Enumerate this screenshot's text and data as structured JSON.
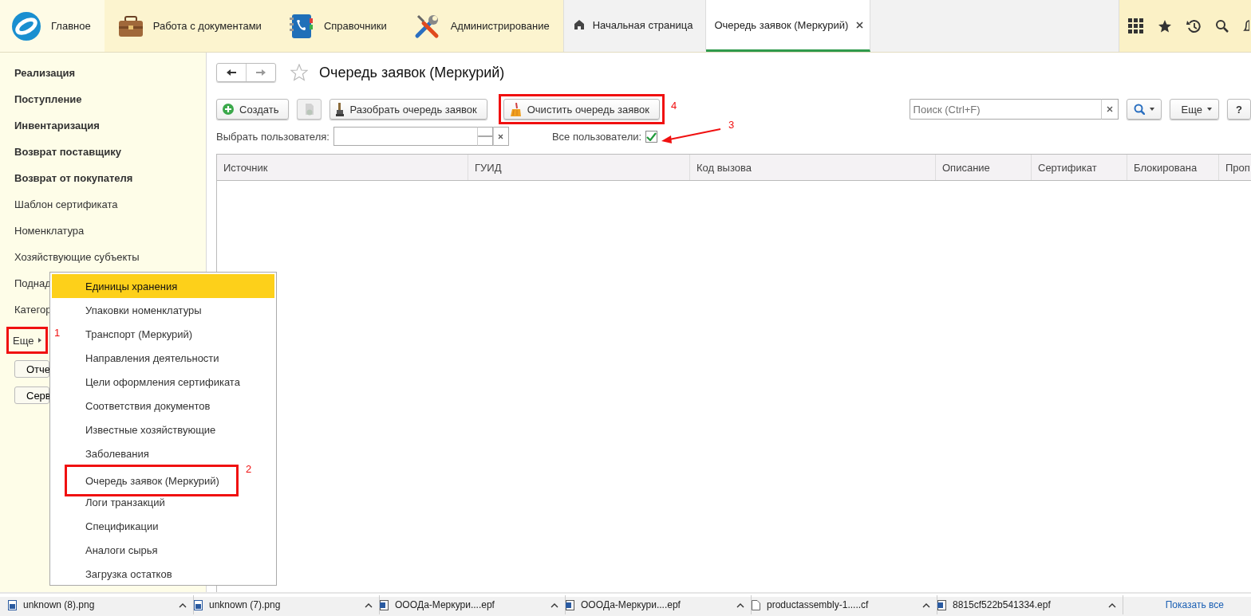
{
  "nav": {
    "sections": [
      {
        "label": "Главное"
      },
      {
        "label": "Работа с документами"
      },
      {
        "label": "Справочники"
      },
      {
        "label": "Администрирование"
      }
    ],
    "tabs": [
      {
        "label": "Начальная страница",
        "selected": false
      },
      {
        "label": "Очередь заявок (Меркурий)",
        "selected": true
      }
    ]
  },
  "sidebar": {
    "items": [
      {
        "label": "Реализация",
        "bold": true
      },
      {
        "label": "Поступление",
        "bold": true
      },
      {
        "label": "Инвентаризация",
        "bold": true
      },
      {
        "label": "Возврат поставщику",
        "bold": true
      },
      {
        "label": "Возврат от покупателя",
        "bold": true
      },
      {
        "label": "Шаблон сертификата",
        "bold": false
      },
      {
        "label": "Номенклатура",
        "bold": false
      },
      {
        "label": "Хозяйствующие субъекты",
        "bold": false
      },
      {
        "label": "Поднад",
        "bold": false
      },
      {
        "label": "Категор",
        "bold": false
      }
    ],
    "more": {
      "label": "Еще",
      "annotation": "1"
    },
    "buttons": [
      "Отче",
      "Серв"
    ]
  },
  "form": {
    "title": "Очередь заявок (Меркурий)",
    "toolbar": [
      {
        "label": "Создать",
        "disabled": false
      },
      {
        "disabled": true
      },
      {
        "label": "Разобрать очередь заявок",
        "disabled": false
      },
      {
        "label": "Очистить очередь заявок",
        "disabled": false,
        "annotation": "4"
      }
    ],
    "search": {
      "placeholder": "Поиск (Ctrl+F)"
    },
    "more_button": "Еще",
    "help_button": "?",
    "filter": {
      "user_label": "Выбрать пользователя:",
      "all_users_label": "Все пользователи:",
      "all_users_checked": true,
      "annotation": "3"
    },
    "table": {
      "columns": [
        "Источник",
        "ГУИД",
        "Код вызова",
        "Описание",
        "Сертификат",
        "Блокирована",
        "Проп"
      ]
    }
  },
  "menu": {
    "items": [
      {
        "label": "Единицы хранения",
        "selected": true
      },
      {
        "label": "Упаковки номенклатуры",
        "selected": false
      },
      {
        "label": "Транспорт (Меркурий)",
        "selected": false
      },
      {
        "label": "Направления деятельности",
        "selected": false
      },
      {
        "label": "Цели оформления сертификата",
        "selected": false
      },
      {
        "label": "Соответствия документов",
        "selected": false
      },
      {
        "label": "Известные хозяйствующие",
        "selected": false
      },
      {
        "label": "Заболевания",
        "selected": false
      },
      {
        "label": "Очередь заявок (Меркурий)",
        "selected": false,
        "annotation": "2"
      },
      {
        "label": "Логи транзакций",
        "selected": false
      },
      {
        "label": "Спецификации",
        "selected": false
      },
      {
        "label": "Аналоги сырья",
        "selected": false
      },
      {
        "label": "Загрузка остатков",
        "selected": false
      }
    ]
  },
  "downloads": {
    "items": [
      {
        "name": "unknown (8).png",
        "kind": "image"
      },
      {
        "name": "unknown (7).png",
        "kind": "image"
      },
      {
        "name": "OOOДа-Меркури....epf",
        "kind": "document"
      },
      {
        "name": "OOOДа-Меркури....epf",
        "kind": "document"
      },
      {
        "name": "productassembly-1.....cf",
        "kind": "file"
      },
      {
        "name": "8815cf522b541334.epf",
        "kind": "document"
      }
    ],
    "show_all": "Показать все"
  }
}
